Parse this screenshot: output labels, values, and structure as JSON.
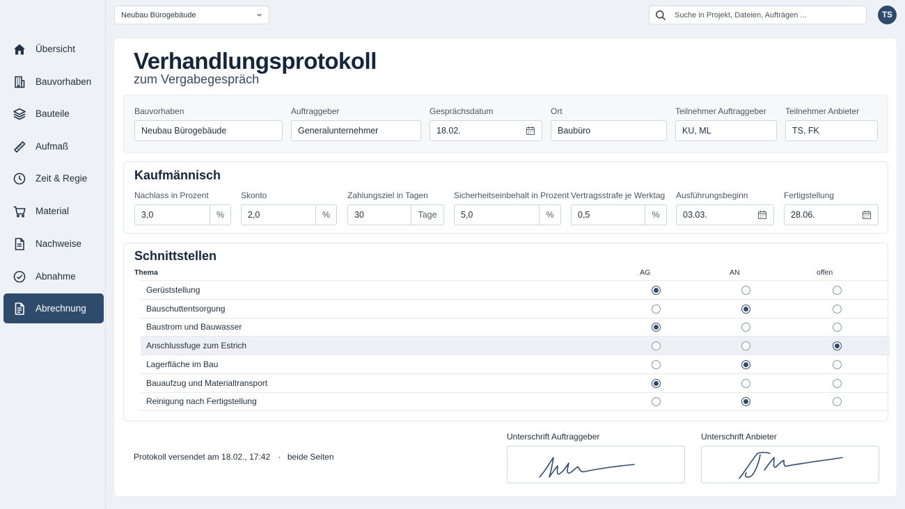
{
  "sidebar": {
    "items": [
      {
        "label": "Übersicht",
        "icon": "home-icon"
      },
      {
        "label": "Bauvorhaben",
        "icon": "building-icon"
      },
      {
        "label": "Bauteile",
        "icon": "layers-icon"
      },
      {
        "label": "Aufmaß",
        "icon": "ruler-icon"
      },
      {
        "label": "Zeit & Regie",
        "icon": "clock-icon"
      },
      {
        "label": "Material",
        "icon": "cart-icon"
      },
      {
        "label": "Nachweise",
        "icon": "document-icon"
      },
      {
        "label": "Abnahme",
        "icon": "check-circle-icon"
      },
      {
        "label": "Abrechnung",
        "icon": "invoice-icon",
        "active": true
      }
    ]
  },
  "header": {
    "project_select": "Neubau Bürogebäude",
    "search_placeholder": "Suche in Projekt, Dateien, Aufträgen ...",
    "avatar_initials": "TS"
  },
  "page": {
    "title": "Verhandlungsprotokoll",
    "subtitle": "zum Vergabegespräch"
  },
  "general": {
    "bauvorhaben": {
      "label": "Bauvorhaben",
      "value": "Neubau Bürogebäude"
    },
    "auftraggeber": {
      "label": "Auftraggeber",
      "value": "Generalunternehmer"
    },
    "datum": {
      "label": "Gesprächsdatum",
      "value": "18.02."
    },
    "ort": {
      "label": "Ort",
      "value": "Baubüro"
    },
    "teilnehmer_ag": {
      "label": "Teilnehmer Auftraggeber",
      "value": "KU, ML"
    },
    "teilnehmer_an": {
      "label": "Teilnehmer Anbieter",
      "value": "TS, FK"
    }
  },
  "kaufmaennisch": {
    "title": "Kaufmännisch",
    "nachlass": {
      "label": "Nachlass in Prozent",
      "value": "3,0",
      "unit": "%"
    },
    "skonto": {
      "label": "Skonto",
      "value": "2,0",
      "unit": "%"
    },
    "zahlungsziel": {
      "label": "Zahlungsziel in Tagen",
      "value": "30",
      "unit": "Tage"
    },
    "sicherheit": {
      "label": "Sicherheitseinbehalt in Prozent",
      "value": "5,0",
      "unit": "%"
    },
    "vertragsstrafe": {
      "label": "Vertragsstrafe je Werktag",
      "value": "0,5",
      "unit": "%"
    },
    "beginn": {
      "label": "Ausführungsbeginn",
      "value": "03.03."
    },
    "fertigstellung": {
      "label": "Fertigstellung",
      "value": "28.06."
    }
  },
  "schnittstellen": {
    "title": "Schnittstellen",
    "columns": {
      "thema": "Thema",
      "ag": "AG",
      "an": "AN",
      "offen": "offen"
    },
    "rows": [
      {
        "thema": "Gerüststellung",
        "selected": "AG"
      },
      {
        "thema": "Bauschuttentsorgung",
        "selected": "AN"
      },
      {
        "thema": "Baustrom und Bauwasser",
        "selected": "AG"
      },
      {
        "thema": "Anschlussfuge zum Estrich",
        "selected": "offen"
      },
      {
        "thema": "Lagerfläche im Bau",
        "selected": "AN"
      },
      {
        "thema": "Bauaufzug und Materialtransport",
        "selected": "AG"
      },
      {
        "thema": "Reinigung nach Fertigstellung",
        "selected": "AN"
      }
    ]
  },
  "footer": {
    "status": "Protokoll versendet am 18.02., 17:42",
    "separator": "·",
    "status_suffix": "beide Seiten",
    "sig_ag_label": "Unterschrift Auftraggeber",
    "sig_an_label": "Unterschrift Anbieter"
  },
  "colors": {
    "accent": "#2f4b6c",
    "highlight_row": "#edf0f4",
    "signature_ink": "#2f4b6c"
  }
}
